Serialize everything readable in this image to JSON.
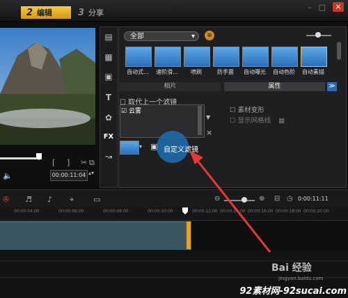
{
  "tabs": [
    {
      "num": "2",
      "label": "编辑"
    },
    {
      "num": "3",
      "label": "分享"
    }
  ],
  "window_controls": {
    "min": "–",
    "max": "□",
    "close": "×"
  },
  "preview": {
    "timecode": "00:00:11:04",
    "bracket_in": "[",
    "bracket_out": "]"
  },
  "library": {
    "category": "全部",
    "filters": [
      {
        "label": "自动式..."
      },
      {
        "label": "速阶滑..."
      },
      {
        "label": "喷刷"
      },
      {
        "label": "防手震"
      },
      {
        "label": "自动曝光"
      },
      {
        "label": "自动色阶"
      },
      {
        "label": "自动素描"
      }
    ],
    "tab_left": "相片",
    "tab_right": "属性"
  },
  "attributes": {
    "replace_last_filter": "取代上一个滤镜",
    "applied_filter": "云雾",
    "variant": "素材变形",
    "show_grid": "显示网格线",
    "custom_filter": "自定义滤镜"
  },
  "timeline": {
    "timecode": "0:00:11:11",
    "ruler": [
      "00:00:04:00",
      "00:00:06:00",
      "00:00:08:00",
      "00:00:10:00",
      "00:00:12:00",
      "00:00:14:00",
      "00:00:16:00",
      "00:00:18:00",
      "00:00:20:00"
    ]
  },
  "watermark": {
    "site": "92素材网-92sucai.com",
    "baidu": "Bai 经验",
    "baidu_url": "jingyan.baidu.com"
  },
  "colors": {
    "accent": "#f0b429",
    "highlight": "#1e6eb4",
    "arrow": "#e53935"
  }
}
